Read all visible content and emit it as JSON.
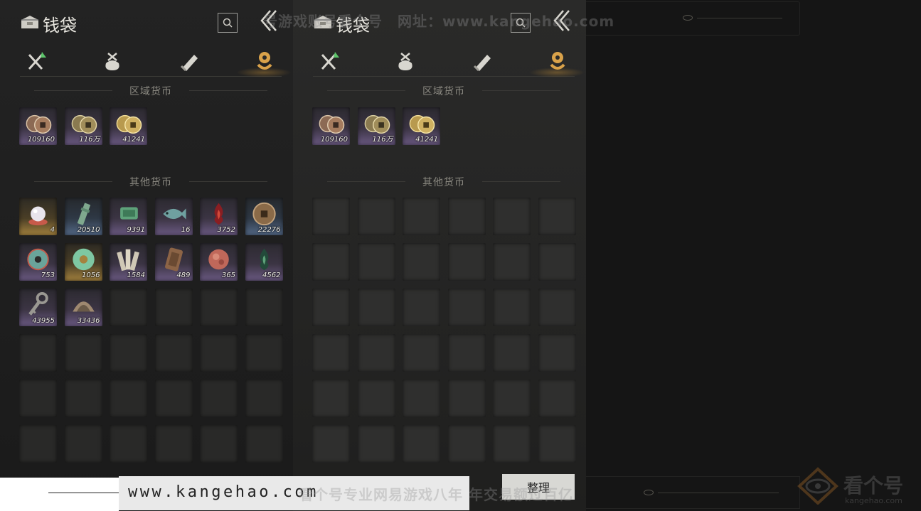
{
  "panel": {
    "title": "钱袋",
    "sections": {
      "regional": "区域货币",
      "other": "其他货币"
    }
  },
  "tabs": [
    {
      "id": "equipment",
      "icon": "crossed-swords-icon"
    },
    {
      "id": "bag",
      "icon": "pouch-icon"
    },
    {
      "id": "scroll",
      "icon": "scroll-icon"
    },
    {
      "id": "currency",
      "icon": "coin-icon",
      "active": true
    }
  ],
  "regional_currency": [
    {
      "icon": "copper-coins-icon",
      "count": "109160",
      "rarity": "purple"
    },
    {
      "icon": "bronze-coins-icon",
      "count": "116万",
      "rarity": "purple"
    },
    {
      "icon": "gold-coins-icon",
      "count": "41241",
      "rarity": "purple"
    }
  ],
  "other_currency": [
    {
      "icon": "pearl-icon",
      "count": "4",
      "rarity": "gold"
    },
    {
      "icon": "jade-pendant-icon",
      "count": "20510",
      "rarity": "blue"
    },
    {
      "icon": "jade-token-icon",
      "count": "9391",
      "rarity": "purple"
    },
    {
      "icon": "jade-fish-icon",
      "count": "16",
      "rarity": "purple"
    },
    {
      "icon": "red-flame-icon",
      "count": "3752",
      "rarity": "purple"
    },
    {
      "icon": "ancient-coin-icon",
      "count": "22276",
      "rarity": "blue"
    },
    {
      "icon": "jade-disc-icon",
      "count": "753",
      "rarity": "purple"
    },
    {
      "icon": "green-jade-ring-icon",
      "count": "1056",
      "rarity": "gold"
    },
    {
      "icon": "bamboo-slips-icon",
      "count": "1584",
      "rarity": "purple"
    },
    {
      "icon": "bronze-tablet-icon",
      "count": "489",
      "rarity": "purple"
    },
    {
      "icon": "red-stone-icon",
      "count": "365",
      "rarity": "purple"
    },
    {
      "icon": "green-flame-icon",
      "count": "4562",
      "rarity": "purple"
    },
    {
      "icon": "iron-key-icon",
      "count": "43955",
      "rarity": "purple"
    },
    {
      "icon": "bronze-shell-icon",
      "count": "33436",
      "rarity": "purple"
    }
  ],
  "buttons": {
    "sort": "整理"
  },
  "watermarks": {
    "top": "号游戏账号看个号　网址：www.kangehao.com",
    "bottom": "看个号专业网易游戏八年 年交易额过百亿",
    "site": "www.kangehao.com",
    "logo_cn": "看个号",
    "logo_en": "kangehao.com"
  },
  "colors": {
    "accent_active_tab": "#d9a24a",
    "rarity_purple": "#6b5a83",
    "rarity_blue": "#546987",
    "rarity_gold": "#a4823e"
  }
}
